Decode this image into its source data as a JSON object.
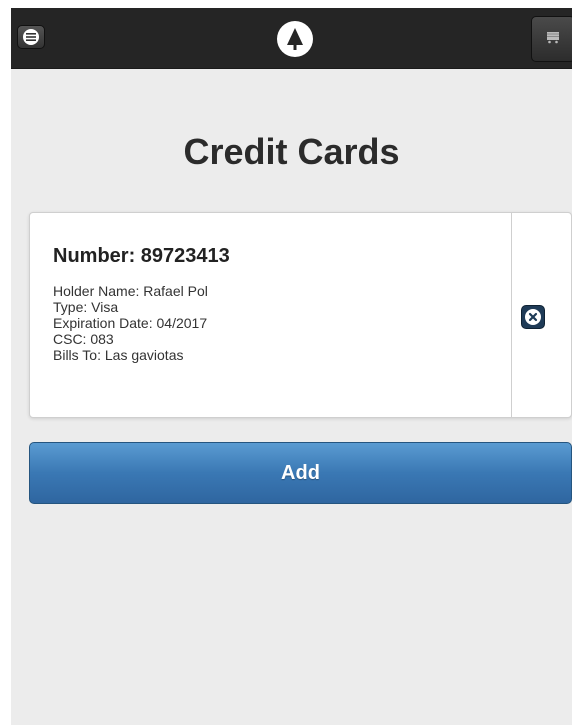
{
  "header": {
    "menu_icon": "menu-icon",
    "logo_icon": "tree-icon",
    "cart_icon": "cart-icon"
  },
  "page": {
    "title": "Credit Cards"
  },
  "cards": [
    {
      "number": "Number: 89723413",
      "holder": "Holder Name: Rafael Pol",
      "type": "Type: Visa",
      "expiration": "Expiration Date: 04/2017",
      "csc": "CSC: 083",
      "bills_to": "Bills To: Las gaviotas",
      "delete_icon": "close-icon"
    }
  ],
  "actions": {
    "add_label": "Add"
  },
  "colors": {
    "header_bg": "#252525",
    "page_bg": "#ececec",
    "add_button": "#3a78b4",
    "delete_button": "#1f3b57"
  }
}
